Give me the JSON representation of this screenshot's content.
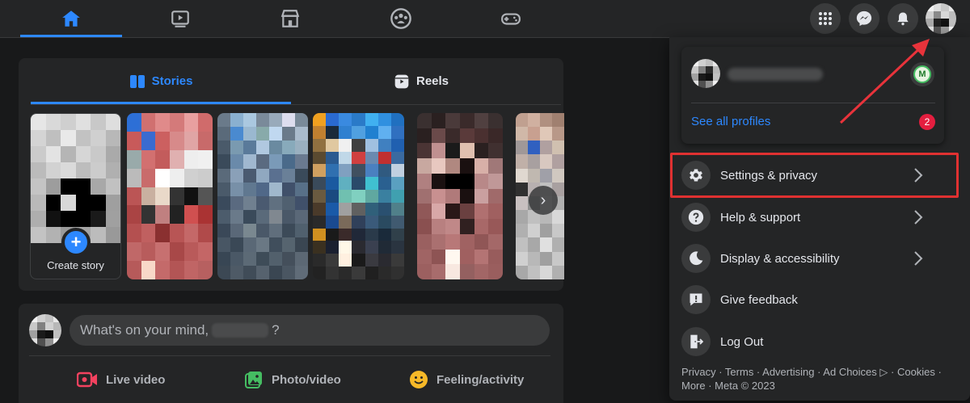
{
  "nav": {
    "tabs": [
      {
        "icon": "home-icon",
        "active": true
      },
      {
        "icon": "watch-icon",
        "active": false
      },
      {
        "icon": "marketplace-icon",
        "active": false
      },
      {
        "icon": "groups-icon",
        "active": false
      },
      {
        "icon": "gaming-icon",
        "active": false
      }
    ],
    "right_icons": [
      "menu-grid-icon",
      "messenger-icon",
      "notifications-icon",
      "account-avatar"
    ]
  },
  "stories_card": {
    "tabs": [
      {
        "label": "Stories",
        "icon": "stories-icon",
        "active": true
      },
      {
        "label": "Reels",
        "icon": "reels-icon",
        "active": false
      }
    ],
    "create_story_label": "Create story"
  },
  "composer": {
    "placeholder_prefix": "What's on your mind,",
    "placeholder_suffix": "?",
    "actions": [
      {
        "label": "Live video",
        "icon": "live-video-icon",
        "color": "#f3425f"
      },
      {
        "label": "Photo/video",
        "icon": "photo-video-icon",
        "color": "#45bd62"
      },
      {
        "label": "Feeling/activity",
        "icon": "feeling-icon",
        "color": "#f7b928"
      }
    ]
  },
  "account_menu": {
    "see_all_profiles": "See all profiles",
    "profiles_badge": "2",
    "items": [
      {
        "label": "Settings & privacy",
        "icon": "gear-icon",
        "has_chevron": true,
        "highlighted": true
      },
      {
        "label": "Help & support",
        "icon": "help-icon",
        "has_chevron": true,
        "highlighted": false
      },
      {
        "label": "Display & accessibility",
        "icon": "moon-icon",
        "has_chevron": true,
        "highlighted": false
      },
      {
        "label": "Give feedback",
        "icon": "feedback-icon",
        "has_chevron": false,
        "highlighted": false
      },
      {
        "label": "Log Out",
        "icon": "logout-icon",
        "has_chevron": false,
        "highlighted": false
      }
    ],
    "footer_line1": "Privacy · Terms · Advertising · Ad Choices ▷ · Cookies ·",
    "footer_line2": "More · Meta © 2023"
  },
  "colors": {
    "accent": "#2d88ff",
    "highlight_box": "#e03131",
    "arrow": "#e8333b",
    "badge": "#e41e3f"
  }
}
